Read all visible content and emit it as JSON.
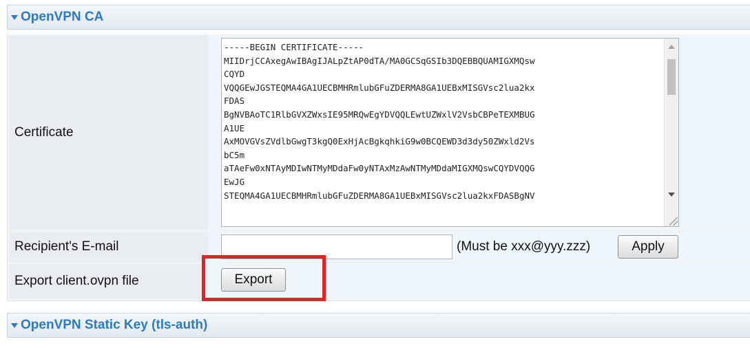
{
  "sections": {
    "ca_title": "OpenVPN CA",
    "tls_title": "OpenVPN Static Key (tls-auth)"
  },
  "certificate": {
    "label": "Certificate",
    "text": "-----BEGIN CERTIFICATE-----\nMIIDrjCCAxegAwIBAgIJALpZtAP0dTA/MA0GCSqGSIb3DQEBBQUAMIGXMQsw\nCQYD\nVQQGEwJGSTEQMA4GA1UECBMHRmlubGFuZDERMA8GA1UEBxMISGVsc2lua2kx\nFDAS\nBgNVBAoTC1RlbGVXZWxsIE95MRQwEgYDVQQLEwtUZWxlV2VsbCBPeTEXMBUG\nA1UE\nAxMOVGVsZVdlbGwgT3kgQ0ExHjAcBgkqhkiG9w0BCQEWD3d3dy50ZWxld2Vs\nbC5m\naTAeFw0xNTAyMDIwNTMyMDdaFw0yNTAxMzAwNTMyMDdaMIGXMQswCQYDVQQG\nEwJG\nSTEQMA4GA1UECBMHRmlubGFuZDERMA8GA1UEBxMISGVsc2lua2kxFDASBgNV"
  },
  "email": {
    "label": "Recipient's E-mail",
    "value": "",
    "hint": "(Must be xxx@yyy.zzz)",
    "apply_label": "Apply"
  },
  "export": {
    "label": "Export client.ovpn file",
    "button_label": "Export"
  },
  "colors": {
    "header_text": "#2a7ac7",
    "highlight": "#e32227"
  }
}
